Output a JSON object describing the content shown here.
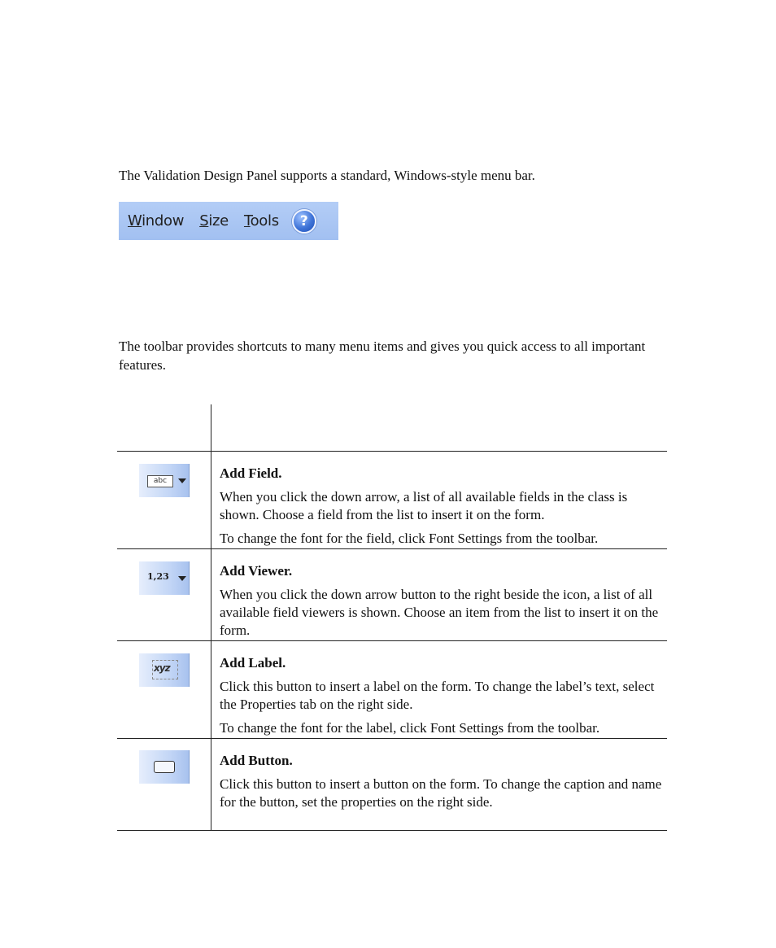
{
  "intro": {
    "paragraph": "The Validation Design Panel supports a standard, Windows-style menu bar."
  },
  "menubar": {
    "items": [
      {
        "mnemonic": "W",
        "rest": "indow"
      },
      {
        "mnemonic": "S",
        "rest": "ize"
      },
      {
        "mnemonic": "T",
        "rest": "ools"
      }
    ],
    "help_glyph": "?"
  },
  "toolbar_intro": {
    "paragraph": "The toolbar provides shortcuts to many menu items and gives you quick access to all important features."
  },
  "table": {
    "rows": [
      {
        "icon": "add-field-icon",
        "icon_text": "abc",
        "title": "Add Field.",
        "paragraphs": [
          "When you click the down arrow, a list of all available fields in the class is shown. Choose a field from the list to insert it on the form.",
          "To change the font for the field, click Font Settings from the toolbar."
        ]
      },
      {
        "icon": "add-viewer-icon",
        "icon_text": "1,23",
        "title": "Add Viewer.",
        "paragraphs": [
          "When you click the down arrow button to the right beside the icon, a list of all available field viewers is shown. Choose an item from the list to insert it on the form."
        ]
      },
      {
        "icon": "add-label-icon",
        "icon_text": "xyz",
        "title": "Add Label.",
        "paragraphs": [
          "Click this button to insert a label on the form. To change the label’s text, select the Properties tab on the right side.",
          "To change the font for the label, click Font Settings from the toolbar."
        ]
      },
      {
        "icon": "add-button-icon",
        "title": "Add Button.",
        "paragraphs": [
          "Click this button to insert a button on the form. To change the caption and name for the button, set the properties on the right side."
        ]
      }
    ]
  }
}
